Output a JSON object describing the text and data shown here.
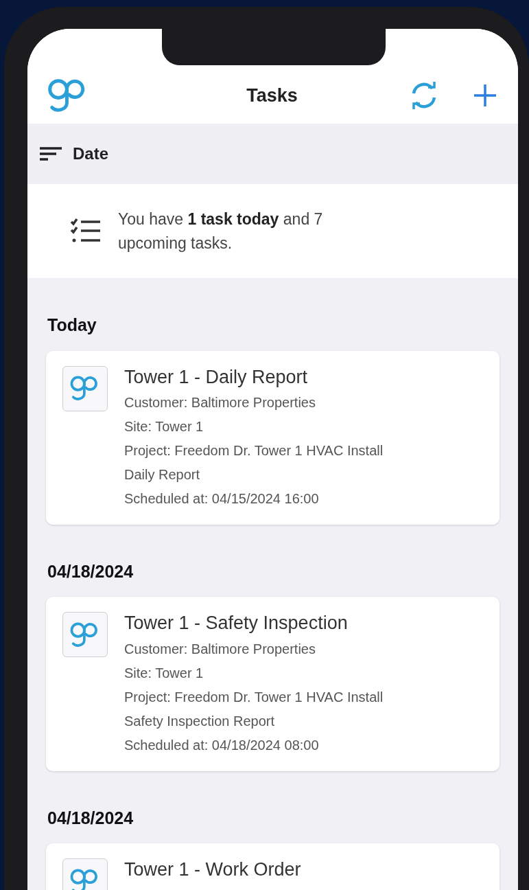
{
  "header": {
    "title": "Tasks"
  },
  "sort": {
    "label": "Date"
  },
  "summary": {
    "text": "You have **1 task today** and 7 upcoming tasks."
  },
  "sections": [
    {
      "heading": "Today",
      "tasks": [
        {
          "title": "Tower 1 - Daily Report",
          "lines": [
            "Customer: Baltimore Properties",
            "Site: Tower 1",
            "Project: Freedom Dr. Tower 1 HVAC Install",
            "Daily Report",
            "Scheduled at: 04/15/2024 16:00"
          ]
        }
      ]
    },
    {
      "heading": "04/18/2024",
      "tasks": [
        {
          "title": "Tower 1 - Safety Inspection",
          "lines": [
            "Customer: Baltimore Properties",
            "Site: Tower 1",
            "Project: Freedom Dr. Tower 1 HVAC Install",
            "Safety Inspection Report",
            "Scheduled at: 04/18/2024 08:00"
          ]
        }
      ]
    },
    {
      "heading": "04/18/2024",
      "tasks": [
        {
          "title": "Tower 1 - Work Order"
        }
      ]
    }
  ]
}
